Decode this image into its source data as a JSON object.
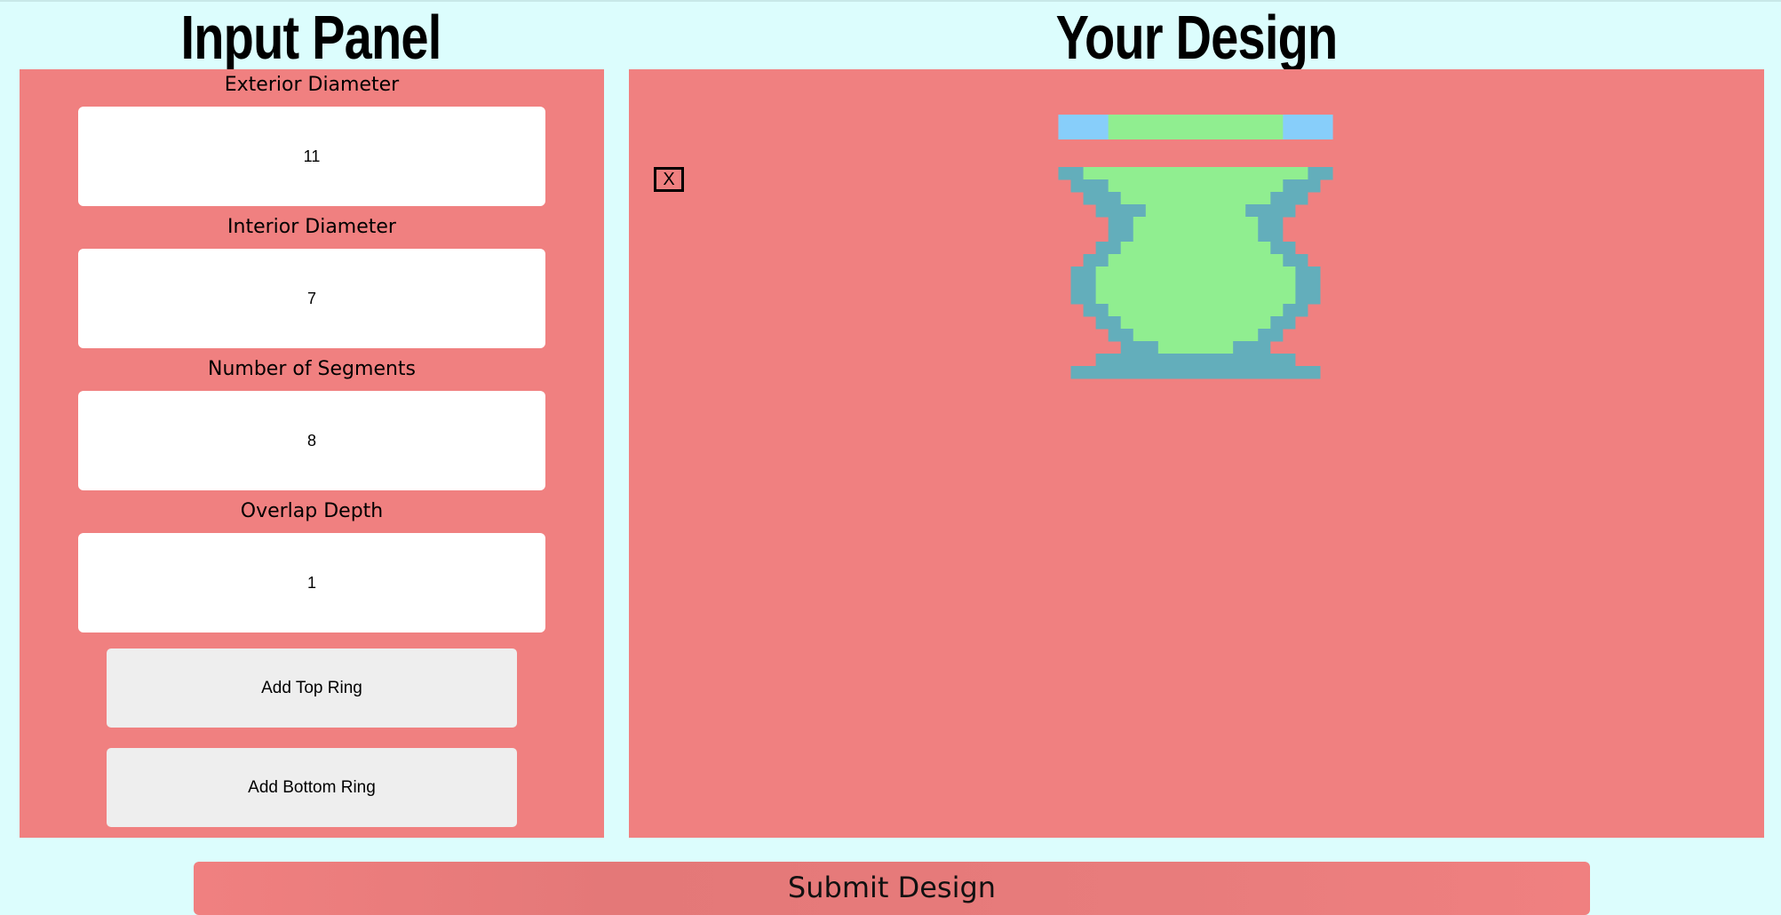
{
  "headings": {
    "input_panel": "Input Panel",
    "your_design": "Your Design"
  },
  "fields": [
    {
      "label": "Exterior Diameter",
      "value": "11"
    },
    {
      "label": "Interior Diameter",
      "value": "7"
    },
    {
      "label": "Number of Segments",
      "value": "8"
    },
    {
      "label": "Overlap Depth",
      "value": "1"
    }
  ],
  "buttons": {
    "add_top_ring": "Add Top Ring",
    "add_bottom_ring": "Add Bottom Ring",
    "submit": "Submit Design"
  },
  "design": {
    "close_label": "X",
    "colors": {
      "panel_bg": "#f08080",
      "segment_outer": "#63aebb",
      "segment_inner": "#90ee90",
      "preview_ring_side": "#87cefa",
      "page_bg": "#dcfdfd"
    },
    "preview_ring": {
      "outer_units": 11,
      "inner_units": 7
    },
    "rings": [
      {
        "outer": 11,
        "inner": 9
      },
      {
        "outer": 10,
        "inner": 7
      },
      {
        "outer": 9,
        "inner": 6
      },
      {
        "outer": 8,
        "inner": 4
      },
      {
        "outer": 7,
        "inner": 5
      },
      {
        "outer": 7,
        "inner": 5
      },
      {
        "outer": 8,
        "inner": 6
      },
      {
        "outer": 9,
        "inner": 7
      },
      {
        "outer": 10,
        "inner": 8
      },
      {
        "outer": 10,
        "inner": 8
      },
      {
        "outer": 10,
        "inner": 8
      },
      {
        "outer": 9,
        "inner": 7
      },
      {
        "outer": 8,
        "inner": 6
      },
      {
        "outer": 7,
        "inner": 5
      },
      {
        "outer": 6,
        "inner": 3
      },
      {
        "outer": 8,
        "inner": 0
      },
      {
        "outer": 10,
        "inner": 0
      }
    ]
  }
}
